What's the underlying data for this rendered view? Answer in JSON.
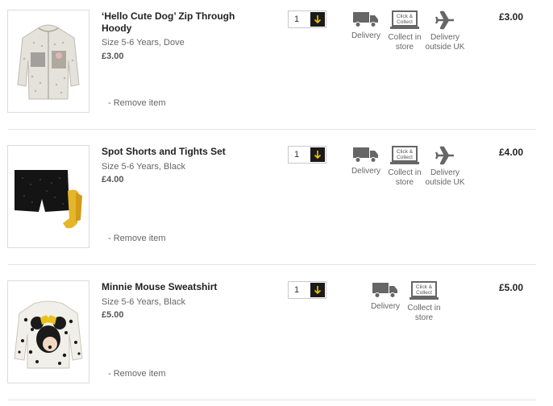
{
  "basket": {
    "remove_label": "- Remove item",
    "delivery_label": "Delivery",
    "collect_label": "Collect in store",
    "collect_icon_text_1": "Click &",
    "collect_icon_text_2": "Collect",
    "outside_uk_label": "Delivery outside UK",
    "accent_color": "#f5c400",
    "items": [
      {
        "title": "‘Hello Cute Dog’ Zip Through Hoody",
        "details": "Size 5-6 Years, Dove",
        "unit_price": "£3.00",
        "quantity": "1",
        "total": "£3.00",
        "image_icon": "grey-hoody-with-dog-print",
        "options": [
          "delivery",
          "collect",
          "outside-uk"
        ]
      },
      {
        "title": "Spot Shorts and Tights Set",
        "details": "Size 5-6 Years, Black",
        "unit_price": "£4.00",
        "quantity": "1",
        "total": "£4.00",
        "image_icon": "black-shorts-and-yellow-tights",
        "options": [
          "delivery",
          "collect",
          "outside-uk"
        ]
      },
      {
        "title": "Minnie Mouse Sweatshirt",
        "details": "Size 5-6 Years, Black",
        "unit_price": "£5.00",
        "quantity": "1",
        "total": "£5.00",
        "image_icon": "minnie-mouse-sweatshirt",
        "options": [
          "delivery",
          "collect"
        ]
      }
    ]
  }
}
